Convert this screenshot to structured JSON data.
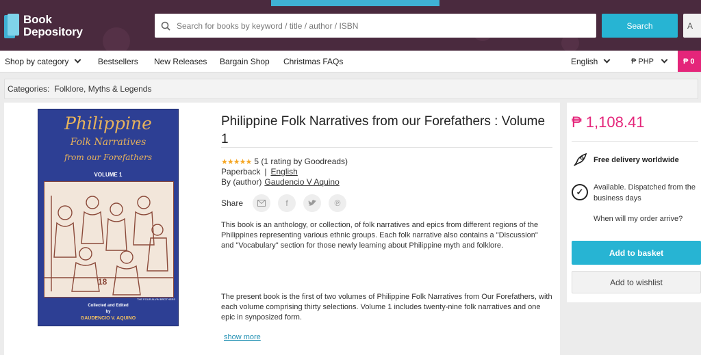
{
  "header": {
    "logo_line1": "Book",
    "logo_line2": "Depository",
    "search_placeholder": "Search for books by keyword / title / author / ISBN",
    "search_button": "Search",
    "account_button": "A"
  },
  "nav": {
    "shop_by_category": "Shop by category",
    "bestsellers": "Bestsellers",
    "new_releases": "New Releases",
    "bargain_shop": "Bargain Shop",
    "christmas_faqs": "Christmas FAQs",
    "language": "English",
    "currency": "₱ PHP",
    "basket": "₱ 0"
  },
  "breadcrumb": {
    "label": "Categories:",
    "category": "Folklore, Myths & Legends"
  },
  "cover": {
    "line1": "Philippine",
    "line2": "Folk Narratives",
    "line3": "from our Forefathers",
    "volume": "VOLUME 1",
    "publisher": "THE FOUR ALVIN BROTHERS",
    "credit1": "Collected and Edited",
    "credit2": "by",
    "credit3": "GAUDENCIO V. AQUINO"
  },
  "book": {
    "title": "Philippine Folk Narratives from our Forefathers : Volume 1",
    "rating_score": 5,
    "rating_text": "5 (1 rating by Goodreads)",
    "format": "Paperback",
    "format_sep": "|",
    "language": "English",
    "author_prefix": "By (author)",
    "author": "Gaudencio V Aquino",
    "share_label": "Share",
    "description1": "This book is an anthology, or collection, of folk narratives and epics from different regions of the Philippines representing various ethnic groups. Each folk narrative also contains a \"Discussion\" and \"Vocabulary\" section for those newly learning about Philippine myth and folklore.",
    "description2": "The present book is the first of two volumes of Philippine Folk Narratives from Our Forefathers, with each volume comprising thirty selections. Volume 1 includes twenty-nine folk narratives and one epic in synposized form.",
    "show_more": "show more"
  },
  "purchase": {
    "price": "₱ 1,108.41",
    "delivery": "Free delivery worldwide",
    "availability": "Available. Dispatched from the business days",
    "when_arrive": "When will my order arrive?",
    "add_to_basket": "Add to basket",
    "add_to_wishlist": "Add to wishlist"
  },
  "icons": {
    "search": "search-icon",
    "rocket": "rocket-icon",
    "check": "check-circle-icon",
    "email": "email-icon",
    "facebook": "facebook-icon",
    "twitter": "twitter-icon",
    "pinterest": "pinterest-icon"
  },
  "colors": {
    "header_bg": "#4a2a3e",
    "accent": "#27b4d3",
    "price": "#e4257a"
  }
}
